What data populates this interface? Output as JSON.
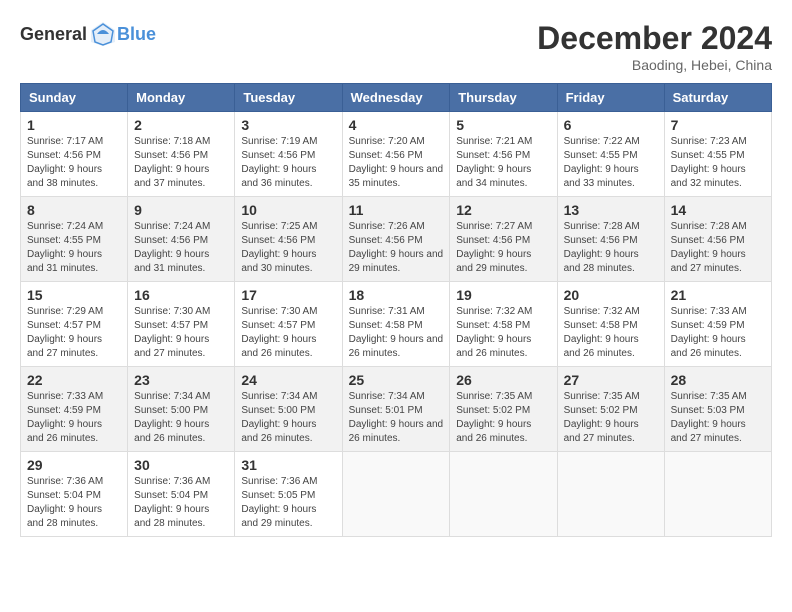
{
  "header": {
    "logo_general": "General",
    "logo_blue": "Blue",
    "month_year": "December 2024",
    "location": "Baoding, Hebei, China"
  },
  "days_of_week": [
    "Sunday",
    "Monday",
    "Tuesday",
    "Wednesday",
    "Thursday",
    "Friday",
    "Saturday"
  ],
  "weeks": [
    [
      {
        "day": "1",
        "info": "Sunrise: 7:17 AM\nSunset: 4:56 PM\nDaylight: 9 hours and 38 minutes."
      },
      {
        "day": "2",
        "info": "Sunrise: 7:18 AM\nSunset: 4:56 PM\nDaylight: 9 hours and 37 minutes."
      },
      {
        "day": "3",
        "info": "Sunrise: 7:19 AM\nSunset: 4:56 PM\nDaylight: 9 hours and 36 minutes."
      },
      {
        "day": "4",
        "info": "Sunrise: 7:20 AM\nSunset: 4:56 PM\nDaylight: 9 hours and 35 minutes."
      },
      {
        "day": "5",
        "info": "Sunrise: 7:21 AM\nSunset: 4:56 PM\nDaylight: 9 hours and 34 minutes."
      },
      {
        "day": "6",
        "info": "Sunrise: 7:22 AM\nSunset: 4:55 PM\nDaylight: 9 hours and 33 minutes."
      },
      {
        "day": "7",
        "info": "Sunrise: 7:23 AM\nSunset: 4:55 PM\nDaylight: 9 hours and 32 minutes."
      }
    ],
    [
      {
        "day": "8",
        "info": "Sunrise: 7:24 AM\nSunset: 4:55 PM\nDaylight: 9 hours and 31 minutes."
      },
      {
        "day": "9",
        "info": "Sunrise: 7:24 AM\nSunset: 4:56 PM\nDaylight: 9 hours and 31 minutes."
      },
      {
        "day": "10",
        "info": "Sunrise: 7:25 AM\nSunset: 4:56 PM\nDaylight: 9 hours and 30 minutes."
      },
      {
        "day": "11",
        "info": "Sunrise: 7:26 AM\nSunset: 4:56 PM\nDaylight: 9 hours and 29 minutes."
      },
      {
        "day": "12",
        "info": "Sunrise: 7:27 AM\nSunset: 4:56 PM\nDaylight: 9 hours and 29 minutes."
      },
      {
        "day": "13",
        "info": "Sunrise: 7:28 AM\nSunset: 4:56 PM\nDaylight: 9 hours and 28 minutes."
      },
      {
        "day": "14",
        "info": "Sunrise: 7:28 AM\nSunset: 4:56 PM\nDaylight: 9 hours and 27 minutes."
      }
    ],
    [
      {
        "day": "15",
        "info": "Sunrise: 7:29 AM\nSunset: 4:57 PM\nDaylight: 9 hours and 27 minutes."
      },
      {
        "day": "16",
        "info": "Sunrise: 7:30 AM\nSunset: 4:57 PM\nDaylight: 9 hours and 27 minutes."
      },
      {
        "day": "17",
        "info": "Sunrise: 7:30 AM\nSunset: 4:57 PM\nDaylight: 9 hours and 26 minutes."
      },
      {
        "day": "18",
        "info": "Sunrise: 7:31 AM\nSunset: 4:58 PM\nDaylight: 9 hours and 26 minutes."
      },
      {
        "day": "19",
        "info": "Sunrise: 7:32 AM\nSunset: 4:58 PM\nDaylight: 9 hours and 26 minutes."
      },
      {
        "day": "20",
        "info": "Sunrise: 7:32 AM\nSunset: 4:58 PM\nDaylight: 9 hours and 26 minutes."
      },
      {
        "day": "21",
        "info": "Sunrise: 7:33 AM\nSunset: 4:59 PM\nDaylight: 9 hours and 26 minutes."
      }
    ],
    [
      {
        "day": "22",
        "info": "Sunrise: 7:33 AM\nSunset: 4:59 PM\nDaylight: 9 hours and 26 minutes."
      },
      {
        "day": "23",
        "info": "Sunrise: 7:34 AM\nSunset: 5:00 PM\nDaylight: 9 hours and 26 minutes."
      },
      {
        "day": "24",
        "info": "Sunrise: 7:34 AM\nSunset: 5:00 PM\nDaylight: 9 hours and 26 minutes."
      },
      {
        "day": "25",
        "info": "Sunrise: 7:34 AM\nSunset: 5:01 PM\nDaylight: 9 hours and 26 minutes."
      },
      {
        "day": "26",
        "info": "Sunrise: 7:35 AM\nSunset: 5:02 PM\nDaylight: 9 hours and 26 minutes."
      },
      {
        "day": "27",
        "info": "Sunrise: 7:35 AM\nSunset: 5:02 PM\nDaylight: 9 hours and 27 minutes."
      },
      {
        "day": "28",
        "info": "Sunrise: 7:35 AM\nSunset: 5:03 PM\nDaylight: 9 hours and 27 minutes."
      }
    ],
    [
      {
        "day": "29",
        "info": "Sunrise: 7:36 AM\nSunset: 5:04 PM\nDaylight: 9 hours and 28 minutes."
      },
      {
        "day": "30",
        "info": "Sunrise: 7:36 AM\nSunset: 5:04 PM\nDaylight: 9 hours and 28 minutes."
      },
      {
        "day": "31",
        "info": "Sunrise: 7:36 AM\nSunset: 5:05 PM\nDaylight: 9 hours and 29 minutes."
      },
      {
        "day": "",
        "info": ""
      },
      {
        "day": "",
        "info": ""
      },
      {
        "day": "",
        "info": ""
      },
      {
        "day": "",
        "info": ""
      }
    ]
  ]
}
